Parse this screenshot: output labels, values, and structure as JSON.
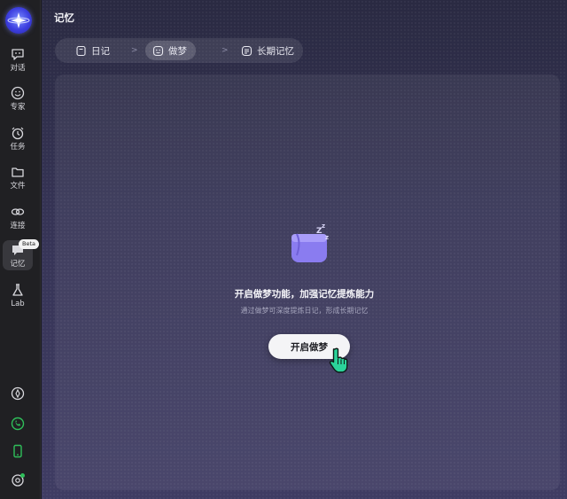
{
  "sidebar": {
    "items": [
      {
        "label": "对话",
        "icon": "chat-bubble-icon"
      },
      {
        "label": "专家",
        "icon": "smiley-icon"
      },
      {
        "label": "任务",
        "icon": "alarm-clock-icon"
      },
      {
        "label": "文件",
        "icon": "folder-icon"
      },
      {
        "label": "连接",
        "icon": "link-icon"
      },
      {
        "label": "记忆",
        "icon": "memory-icon",
        "active": true,
        "badge": "Beta"
      },
      {
        "label": "Lab",
        "icon": "flask-icon"
      }
    ],
    "bottom_icons": [
      "compass-icon",
      "green-phone-icon",
      "mobile-device-icon",
      "settings-icon"
    ]
  },
  "page": {
    "title": "记忆"
  },
  "tabs": [
    {
      "label": "日记",
      "icon": "diary-icon"
    },
    {
      "label": "做梦",
      "icon": "dream-face-icon",
      "active": true
    },
    {
      "label": "长期记忆",
      "icon": "list-icon"
    }
  ],
  "tab_separator": ">",
  "empty_state": {
    "headline": "开启做梦功能，加强记忆提炼能力",
    "subline": "通过做梦可深度提炼日记，形成长期记忆",
    "button_label": "开启做梦"
  },
  "colors": {
    "accent_logo": "#3d3fe0",
    "dream_purple": "#8a7cf0",
    "moon_yellow": "#f5c842",
    "cursor_green": "#2bd39a"
  }
}
